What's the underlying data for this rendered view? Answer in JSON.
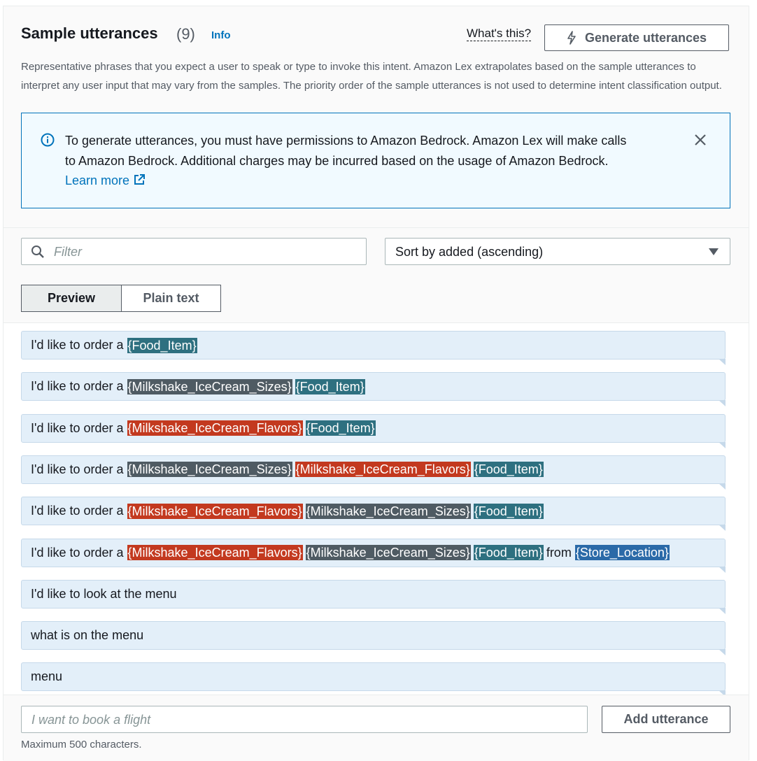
{
  "header": {
    "title": "Sample utterances",
    "count": "(9)",
    "info_link": "Info",
    "whats_this": "What's this?",
    "generate_label": "Generate utterances",
    "description": "Representative phrases that you expect a user to speak or type to invoke this intent. Amazon Lex extrapolates based on the sample utterances to interpret any user input that may vary from the samples. The priority order of the sample utterances is not used to determine intent classification output."
  },
  "alert": {
    "text": "To generate utterances, you must have permissions to Amazon Bedrock. Amazon Lex will make calls to Amazon Bedrock. Additional charges may be incurred based on the usage of Amazon Bedrock.",
    "link_text": "Learn more"
  },
  "controls": {
    "filter_placeholder": "Filter",
    "sort_value": "Sort by added (ascending)",
    "tab_preview": "Preview",
    "tab_plain": "Plain text"
  },
  "slot_colors": {
    "Food_Item": "#2e7080",
    "Milkshake_IceCream_Sizes": "#4f5b63",
    "Milkshake_IceCream_Flavors": "#c3391f",
    "Store_Location": "#2b6aa8"
  },
  "utterances": [
    [
      {
        "t": "I'd like to order a"
      },
      {
        "s": "{Food_Item}",
        "k": "Food_Item"
      }
    ],
    [
      {
        "t": "I'd like to order a"
      },
      {
        "s": "{Milkshake_IceCream_Sizes}",
        "k": "Milkshake_IceCream_Sizes"
      },
      {
        "s": "{Food_Item}",
        "k": "Food_Item"
      }
    ],
    [
      {
        "t": "I'd like to order a"
      },
      {
        "s": "{Milkshake_IceCream_Flavors}",
        "k": "Milkshake_IceCream_Flavors"
      },
      {
        "s": "{Food_Item}",
        "k": "Food_Item"
      }
    ],
    [
      {
        "t": "I'd like to order a"
      },
      {
        "s": "{Milkshake_IceCream_Sizes}",
        "k": "Milkshake_IceCream_Sizes"
      },
      {
        "s": "{Milkshake_IceCream_Flavors}",
        "k": "Milkshake_IceCream_Flavors"
      },
      {
        "s": "{Food_Item}",
        "k": "Food_Item"
      }
    ],
    [
      {
        "t": "I'd like to order a"
      },
      {
        "s": "{Milkshake_IceCream_Flavors}",
        "k": "Milkshake_IceCream_Flavors"
      },
      {
        "s": "{Milkshake_IceCream_Sizes}",
        "k": "Milkshake_IceCream_Sizes"
      },
      {
        "s": "{Food_Item}",
        "k": "Food_Item"
      }
    ],
    [
      {
        "t": "I'd like to order a"
      },
      {
        "s": "{Milkshake_IceCream_Flavors}",
        "k": "Milkshake_IceCream_Flavors"
      },
      {
        "s": "{Milkshake_IceCream_Sizes}",
        "k": "Milkshake_IceCream_Sizes"
      },
      {
        "s": "{Food_Item}",
        "k": "Food_Item"
      },
      {
        "t": "from"
      },
      {
        "s": "{Store_Location}",
        "k": "Store_Location"
      }
    ],
    [
      {
        "t": "I'd like to look at the menu"
      }
    ],
    [
      {
        "t": "what is on the menu"
      }
    ],
    [
      {
        "t": "menu"
      }
    ]
  ],
  "footer": {
    "input_placeholder": "I want to book a flight",
    "add_label": "Add utterance",
    "hint": "Maximum 500 characters."
  }
}
